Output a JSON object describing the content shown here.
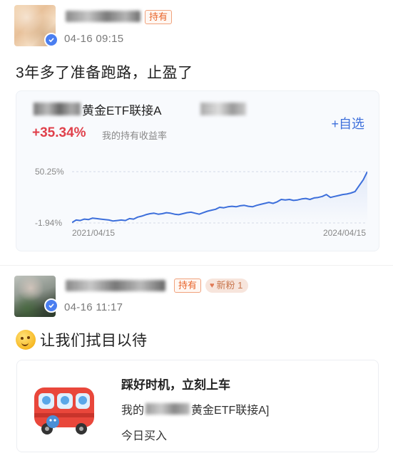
{
  "post1": {
    "hold_tag": "持有",
    "time": "04-16 09:15",
    "text": "3年多了准备跑路，止盈了",
    "fund_card": {
      "fund_name": "黄金ETF联接A",
      "follow_label": "+自选",
      "return_rate": "+35.34%",
      "return_label": "我的持有收益率",
      "accent_color": "#3d6fdb",
      "return_color": "#e0404b"
    }
  },
  "post2": {
    "hold_tag": "持有",
    "fans_tag": "新粉 1",
    "time": "04-16 11:17",
    "text": "让我们拭目以待",
    "share_card": {
      "title": "踩好时机，立刻上车",
      "line_prefix": "我的",
      "line_fund": "黄金ETF联接A]",
      "sub": "今日买入"
    }
  },
  "chart_data": {
    "type": "line",
    "x_start": "2021/04/15",
    "x_end": "2024/04/15",
    "y_max_label": "50.25%",
    "y_min_label": "-1.94%",
    "ylim": [
      -1.94,
      50.25
    ],
    "series": [
      {
        "color": "#3d6fdb",
        "values": [
          -1.5,
          1.0,
          0.5,
          2.0,
          1.5,
          3.0,
          2.5,
          2.0,
          1.5,
          1.0,
          0.0,
          0.5,
          1.0,
          0.5,
          2.5,
          2.0,
          4.0,
          5.0,
          6.5,
          7.5,
          8.0,
          7.0,
          7.5,
          8.5,
          8.0,
          7.0,
          6.5,
          7.5,
          8.5,
          9.0,
          8.0,
          7.0,
          8.5,
          10.0,
          11.0,
          12.0,
          14.0,
          13.5,
          14.5,
          15.0,
          14.5,
          15.5,
          16.0,
          15.0,
          14.5,
          16.0,
          17.0,
          18.0,
          19.0,
          18.0,
          19.5,
          22.0,
          21.5,
          22.0,
          21.0,
          21.5,
          22.5,
          23.0,
          22.0,
          23.5,
          24.0,
          25.0,
          27.0,
          24.0,
          25.0,
          26.0,
          27.0,
          27.5,
          28.5,
          30.0,
          36.0,
          42.0,
          50.25
        ]
      }
    ]
  }
}
